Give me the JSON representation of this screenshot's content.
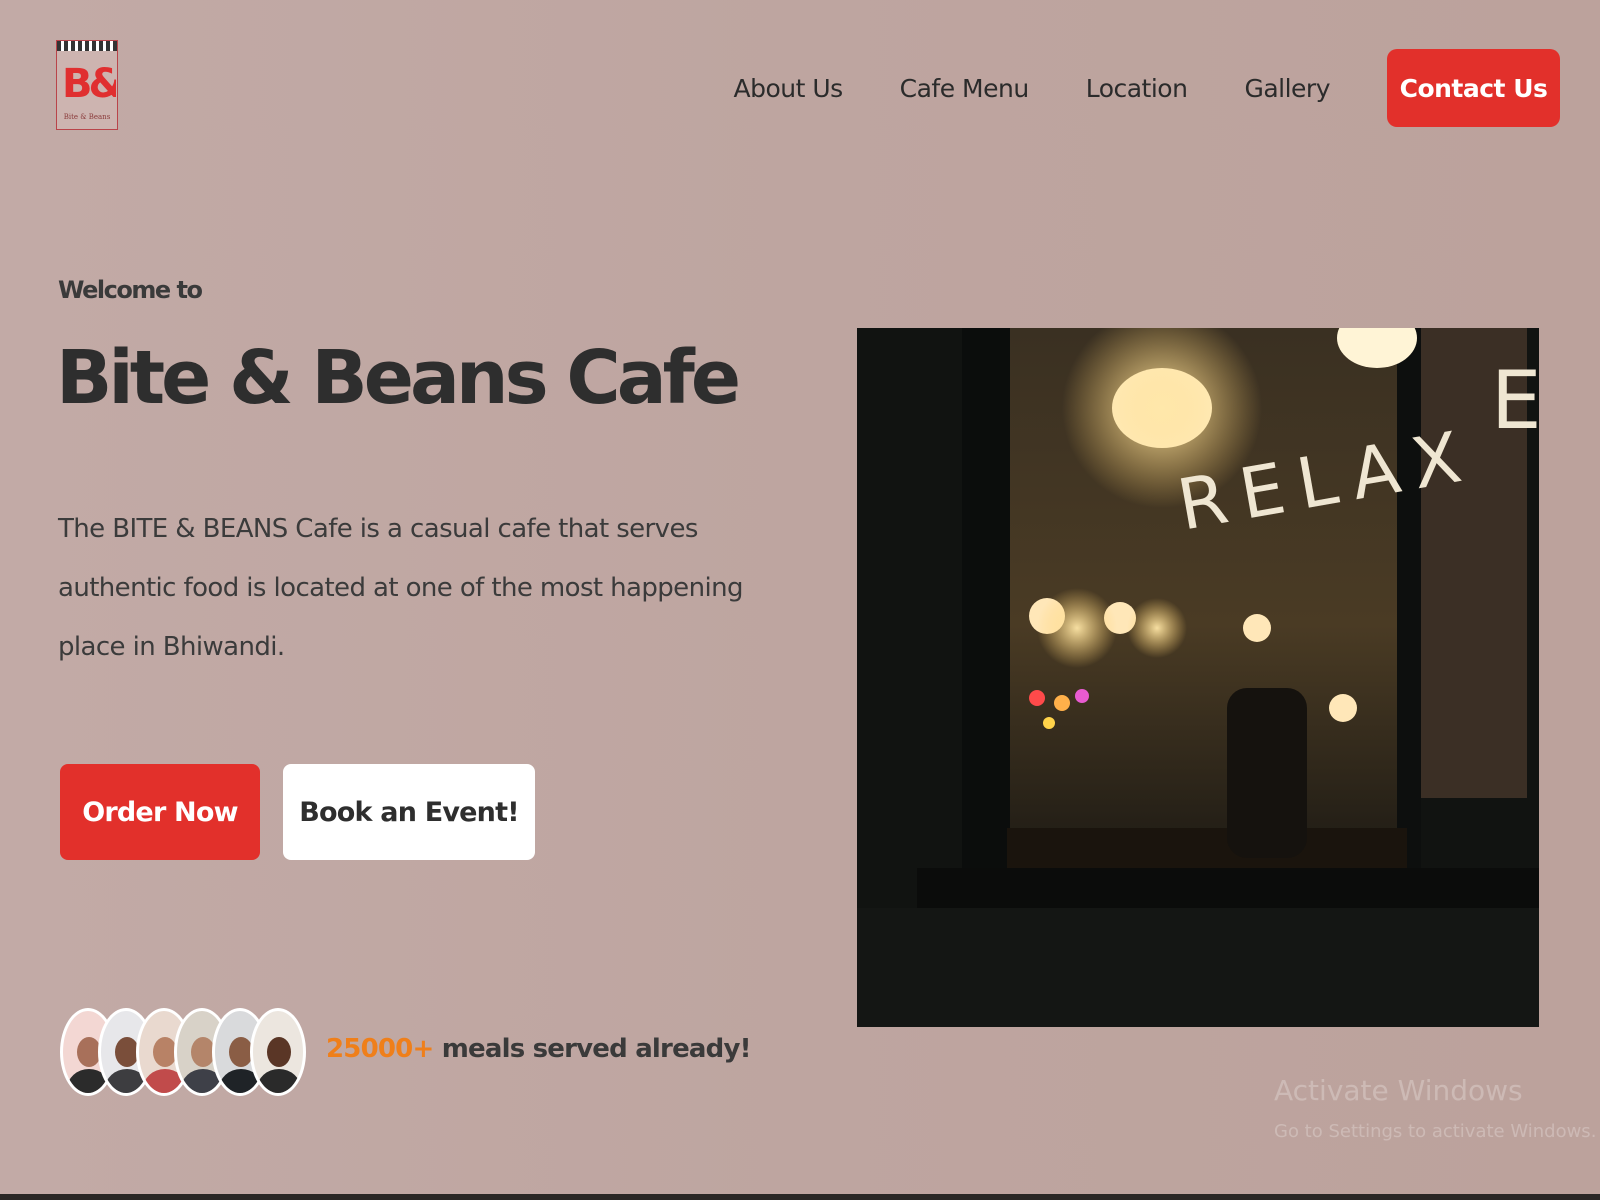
{
  "header": {
    "logo": {
      "mark": "B&B",
      "tagline": "Bite & Beans"
    },
    "nav": [
      {
        "label": "About Us"
      },
      {
        "label": "Cafe Menu"
      },
      {
        "label": "Location"
      },
      {
        "label": "Gallery"
      }
    ],
    "cta_label": "Contact Us"
  },
  "hero": {
    "welcome": "Welcome to",
    "title": "Bite & Beans Cafe",
    "description": "The BITE & BEANS Cafe is a casual cafe that serves authentic food is located at one of the most happening place in Bhiwandi.",
    "primary_button": "Order Now",
    "secondary_button": "Book an Event!",
    "stats": {
      "count": "25000+",
      "text": " meals served already!"
    },
    "photo": {
      "window_text": "RELAX",
      "edge_letter": "E"
    }
  },
  "os_watermark": {
    "title": "Activate Windows",
    "subtitle": "Go to Settings to activate Windows."
  },
  "colors": {
    "accent": "#e2302b",
    "stat_highlight": "#ef7f1a",
    "text_dark": "#2e2e2e"
  },
  "icons": {
    "logo": "storefront-awning-logo"
  }
}
